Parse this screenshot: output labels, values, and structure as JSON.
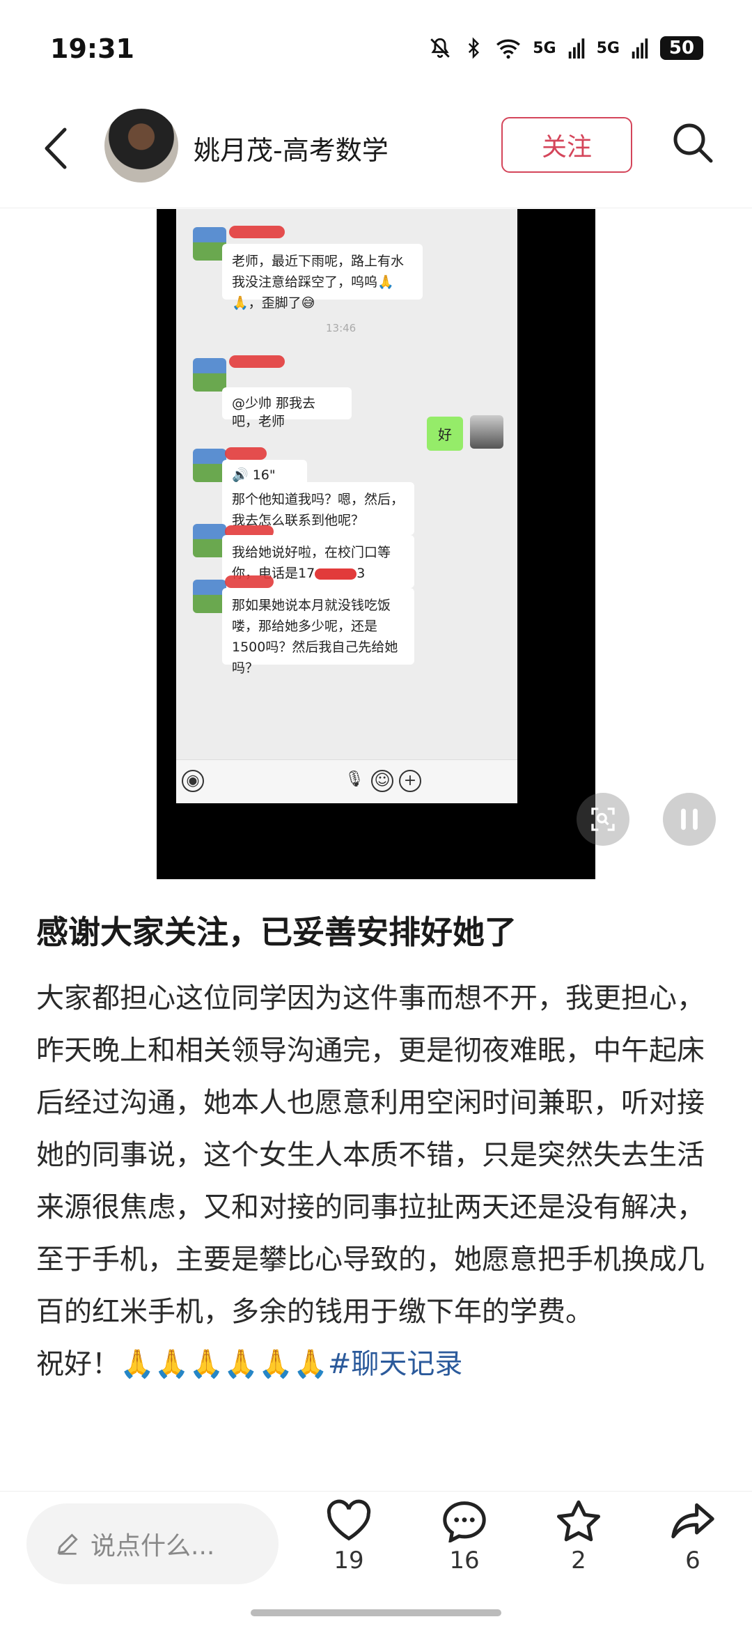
{
  "status_bar": {
    "time": "19:31",
    "battery": "50",
    "network_1": "5G",
    "network_2": "5G"
  },
  "header": {
    "author": "姚月茂-高考数学",
    "follow_label": "关注"
  },
  "chat": {
    "msg1": "老师，最近下雨呢，路上有水我没注意给踩空了，呜呜🙏🙏，歪脚了😅",
    "timestamp": "13:46",
    "msg2": "@少帅  那我去吧，老师",
    "reply": "好",
    "voice": "16\"",
    "msg3": "那个他知道我吗？嗯，然后，我去怎么联系到他呢？",
    "msg4": "我给她说好啦，在校门口等你，电话是17",
    "msg4_tail": "3",
    "msg5": "那如果她说本月就没钱吃饭喽，那给她多少呢，还是1500吗？然后我自己先给她吗？"
  },
  "post": {
    "title": "感谢大家关注，已妥善安排好她了",
    "body": "大家都担心这位同学因为这件事而想不开，我更担心，昨天晚上和相关领导沟通完，更是彻夜难眠，中午起床后经过沟通，她本人也愿意利用空闲时间兼职，听对接她的同事说，这个女生人本质不错，只是突然失去生活来源很焦虑，又和对接的同事拉扯两天还是没有解决，至于手机，主要是攀比心导致的，她愿意把手机换成几百的红米手机，多余的钱用于缴下年的学费。",
    "closing": "祝好！🙏🙏🙏🙏🙏🙏",
    "hashtag": "#聊天记录"
  },
  "bottom_bar": {
    "comment_placeholder": "说点什么...",
    "likes": "19",
    "comments": "16",
    "favorites": "2",
    "shares": "6"
  },
  "colors": {
    "accent": "#d4455a",
    "hashtag": "#2b5a9b"
  }
}
